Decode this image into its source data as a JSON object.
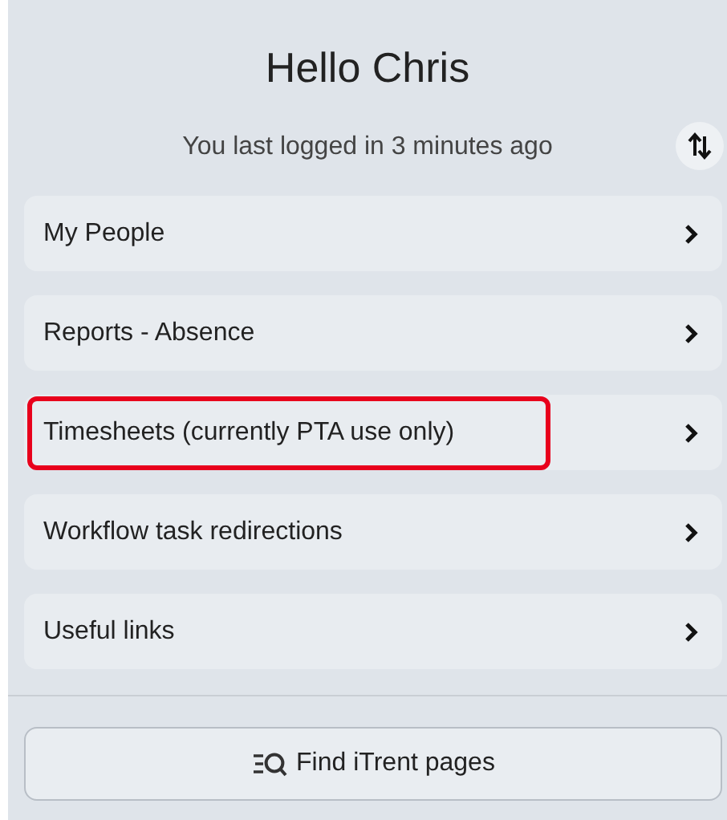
{
  "greeting": "Hello Chris",
  "last_login": "You last logged in 3 minutes ago",
  "menu_items": [
    {
      "label": "My People",
      "highlighted": false
    },
    {
      "label": "Reports - Absence",
      "highlighted": false
    },
    {
      "label": "Timesheets (currently PTA use only)",
      "highlighted": true
    },
    {
      "label": "Workflow task redirections",
      "highlighted": false
    },
    {
      "label": "Useful links",
      "highlighted": false
    }
  ],
  "find_button": {
    "label": "Find iTrent pages"
  }
}
